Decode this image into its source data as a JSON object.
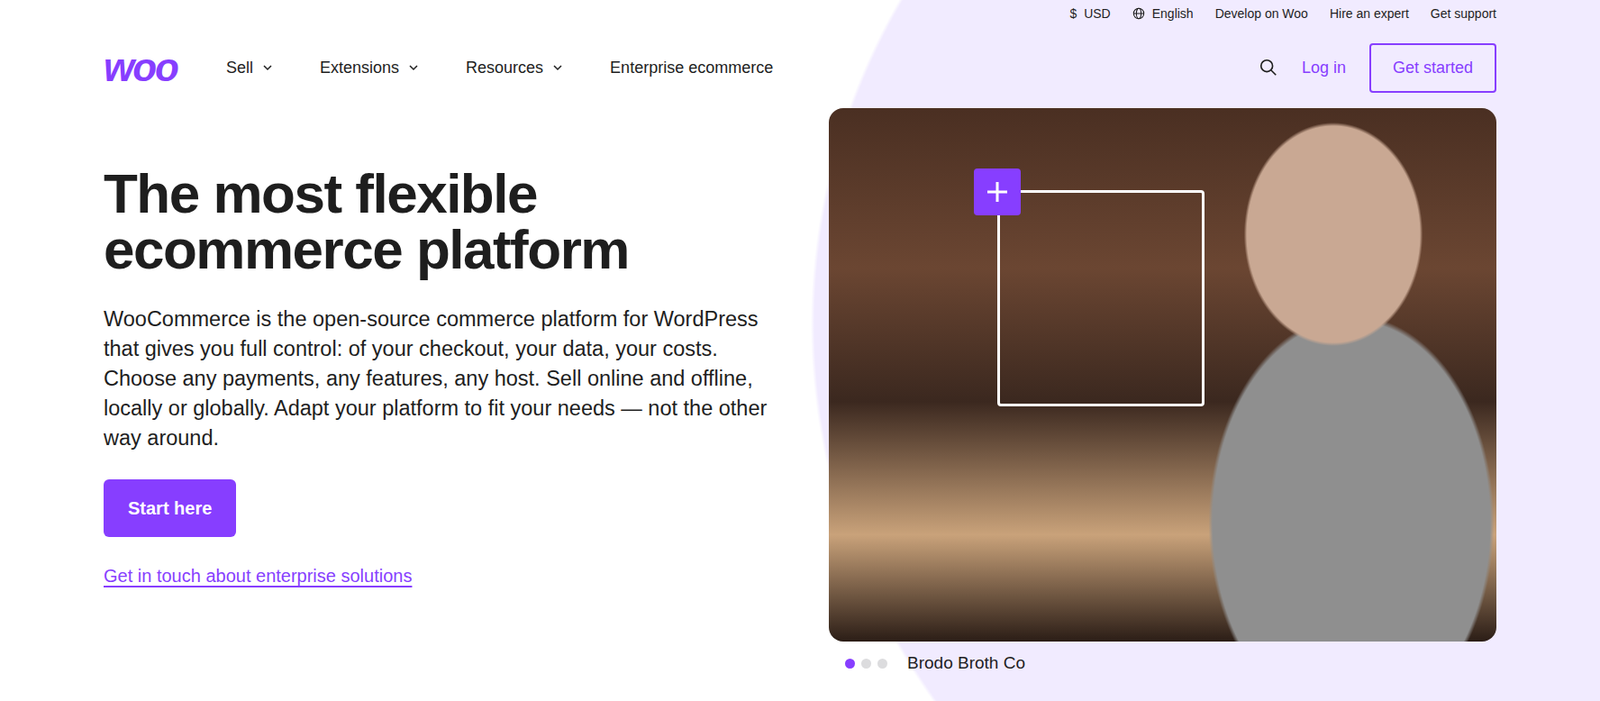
{
  "top_bar": {
    "currency": {
      "symbol": "$",
      "label": "USD"
    },
    "language": "English",
    "links": [
      "Develop on Woo",
      "Hire an expert",
      "Get support"
    ]
  },
  "logo": "woo",
  "nav": [
    {
      "label": "Sell",
      "dropdown": true
    },
    {
      "label": "Extensions",
      "dropdown": true
    },
    {
      "label": "Resources",
      "dropdown": true
    },
    {
      "label": "Enterprise ecommerce",
      "dropdown": false
    }
  ],
  "actions": {
    "login": "Log in",
    "get_started": "Get started"
  },
  "hero": {
    "title": "The most flexible ecommerce platform",
    "body": "WooCommerce is the open-source commerce platform for WordPress that gives you full control: of your checkout, your data, your costs. Choose any payments, any features, any host. Sell online and offline, locally or globally. Adapt your platform to fit your needs — not the other way around.",
    "primary_button": "Start here",
    "link": "Get in touch about enterprise solutions"
  },
  "carousel": {
    "slides": [
      {
        "selected": true
      },
      {
        "selected": false
      },
      {
        "selected": false
      }
    ],
    "caption": "Brodo Broth Co"
  }
}
